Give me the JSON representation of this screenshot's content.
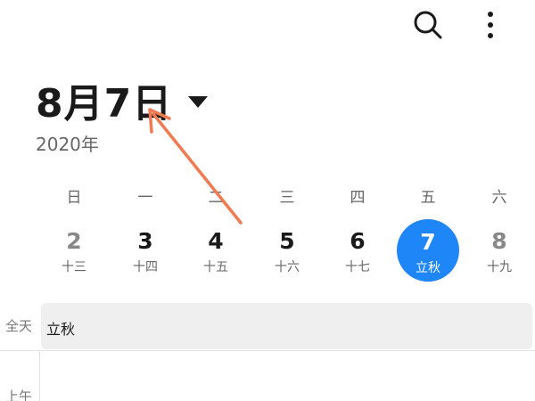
{
  "toolbar": {
    "search_icon": "search-icon",
    "more_icon": "more-vertical-icon"
  },
  "header": {
    "date": "8月7日",
    "year": "2020年"
  },
  "week": {
    "weekdays": [
      "日",
      "一",
      "二",
      "三",
      "四",
      "五",
      "六"
    ],
    "days": [
      {
        "num": "2",
        "lunar": "十三"
      },
      {
        "num": "3",
        "lunar": "十四"
      },
      {
        "num": "4",
        "lunar": "十五"
      },
      {
        "num": "5",
        "lunar": "十六"
      },
      {
        "num": "6",
        "lunar": "十七"
      },
      {
        "num": "7",
        "lunar": "立秋",
        "selected": true
      },
      {
        "num": "8",
        "lunar": "十九"
      }
    ]
  },
  "allday": {
    "label": "全天",
    "event": "立秋"
  },
  "timeline": {
    "period_label": "上午"
  },
  "colors": {
    "accent": "#1e86f7",
    "annotation": "#f07a52"
  }
}
